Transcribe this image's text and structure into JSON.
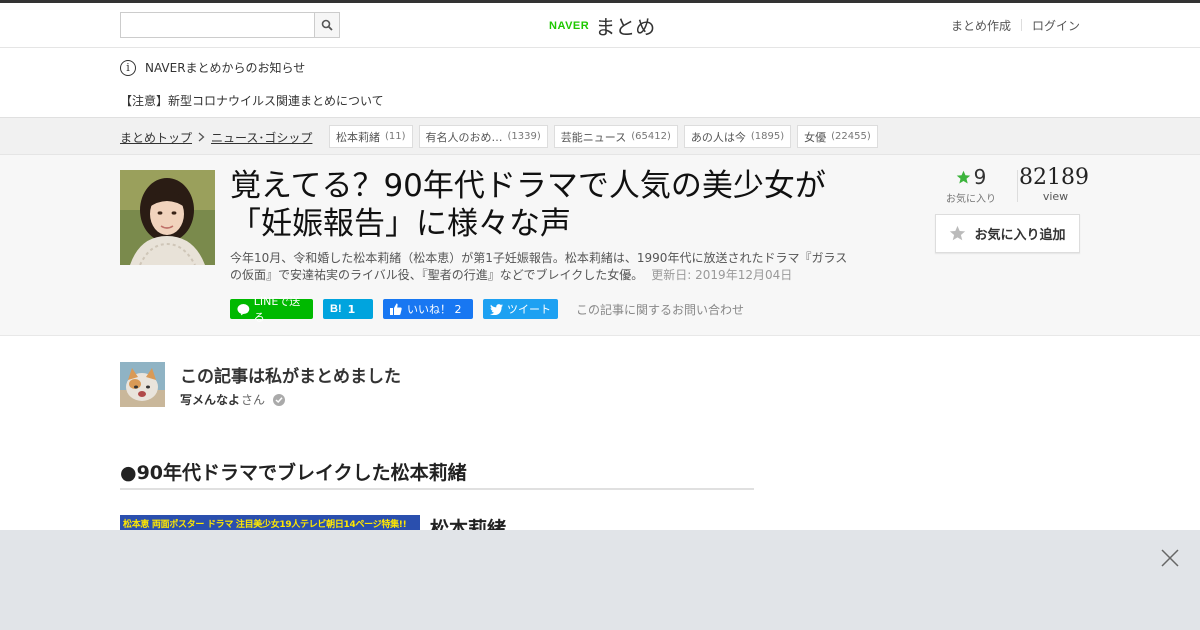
{
  "header": {
    "search_placeholder": "",
    "logo_brand": "NAVER",
    "logo_name": "まとめ",
    "nav": [
      "まとめ作成",
      "ログイン"
    ]
  },
  "notice": {
    "heading": "NAVERまとめからのお知らせ",
    "item": "【注意】新型コロナウイルス関連まとめについて"
  },
  "breadcrumb": [
    "まとめトップ",
    "ニュース･ゴシップ"
  ],
  "tags": [
    {
      "label": "松本莉緒",
      "count": "(11)"
    },
    {
      "label": "有名人のおめ…",
      "count": "(1339)"
    },
    {
      "label": "芸能ニュース",
      "count": "(65412)"
    },
    {
      "label": "あの人は今",
      "count": "(1895)"
    },
    {
      "label": "女優",
      "count": "(22455)"
    }
  ],
  "article": {
    "title": "覚えてる？90年代ドラマで人気の美少女が「妊娠報告」に様々な声",
    "description": "今年10月、令和婚した松本莉緒（松本恵）が第1子妊娠報告。松本莉緒は、1990年代に放送されたドラマ『ガラスの仮面』で安達祐実のライバル役、『聖者の行進』などでブレイクした女優。",
    "updated": "更新日: 2019年12月04日",
    "favorites": "9",
    "favorites_label": "お気に入り",
    "views": "82189",
    "views_label": "view",
    "fav_button": "お気に入り追加"
  },
  "share": {
    "line": "LINEで送る",
    "hatena": "1",
    "facebook": "いいね！ 2",
    "twitter": "ツイート",
    "inquiry": "この記事に関するお問い合わせ"
  },
  "author": {
    "heading": "この記事は私がまとめました",
    "name": "写メんなよ",
    "suffix": "さん"
  },
  "section": {
    "heading": "●90年代ドラマでブレイクした松本莉緒",
    "image_banner": "松本恵 両面ポスター ドラマ 注目美少女19人テレビ朝日14ページ特集!!",
    "item_title": "松本莉緒"
  },
  "colors": {
    "naver_green": "#1ec800",
    "line_green": "#00b900",
    "hatena_blue": "#00a4de",
    "facebook_blue": "#1877f2",
    "twitter_blue": "#1da1f2",
    "star_green": "#3cb43c"
  }
}
